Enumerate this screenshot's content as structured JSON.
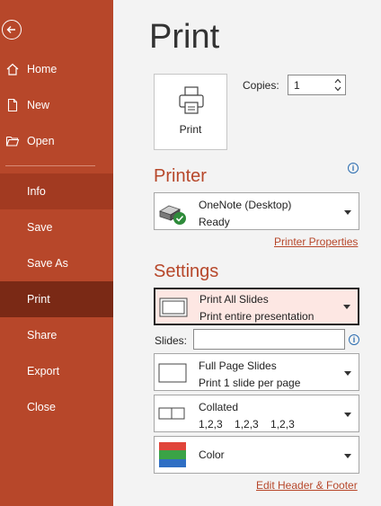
{
  "nav": {
    "items": [
      {
        "label": "Home",
        "icon": "home-icon"
      },
      {
        "label": "New",
        "icon": "new-document-icon"
      },
      {
        "label": "Open",
        "icon": "open-folder-icon"
      },
      {
        "label": "Info"
      },
      {
        "label": "Save"
      },
      {
        "label": "Save As"
      },
      {
        "label": "Print"
      },
      {
        "label": "Share"
      },
      {
        "label": "Export"
      },
      {
        "label": "Close"
      }
    ],
    "active": "Print",
    "accent": "#b7472a"
  },
  "page": {
    "title": "Print",
    "print_button_label": "Print",
    "copies_label": "Copies:",
    "copies_value": "1"
  },
  "printer": {
    "section_label": "Printer",
    "name": "OneNote (Desktop)",
    "status": "Ready",
    "properties_link": "Printer Properties"
  },
  "settings": {
    "section_label": "Settings",
    "range_title": "Print All Slides",
    "range_desc": "Print entire presentation",
    "slides_label": "Slides:",
    "slides_value": "",
    "layout_title": "Full Page Slides",
    "layout_desc": "Print 1 slide per page",
    "collate_title": "Collated",
    "collate_desc": "1,2,3    1,2,3    1,2,3",
    "color_title": "Color",
    "footer_link": "Edit Header & Footer"
  }
}
